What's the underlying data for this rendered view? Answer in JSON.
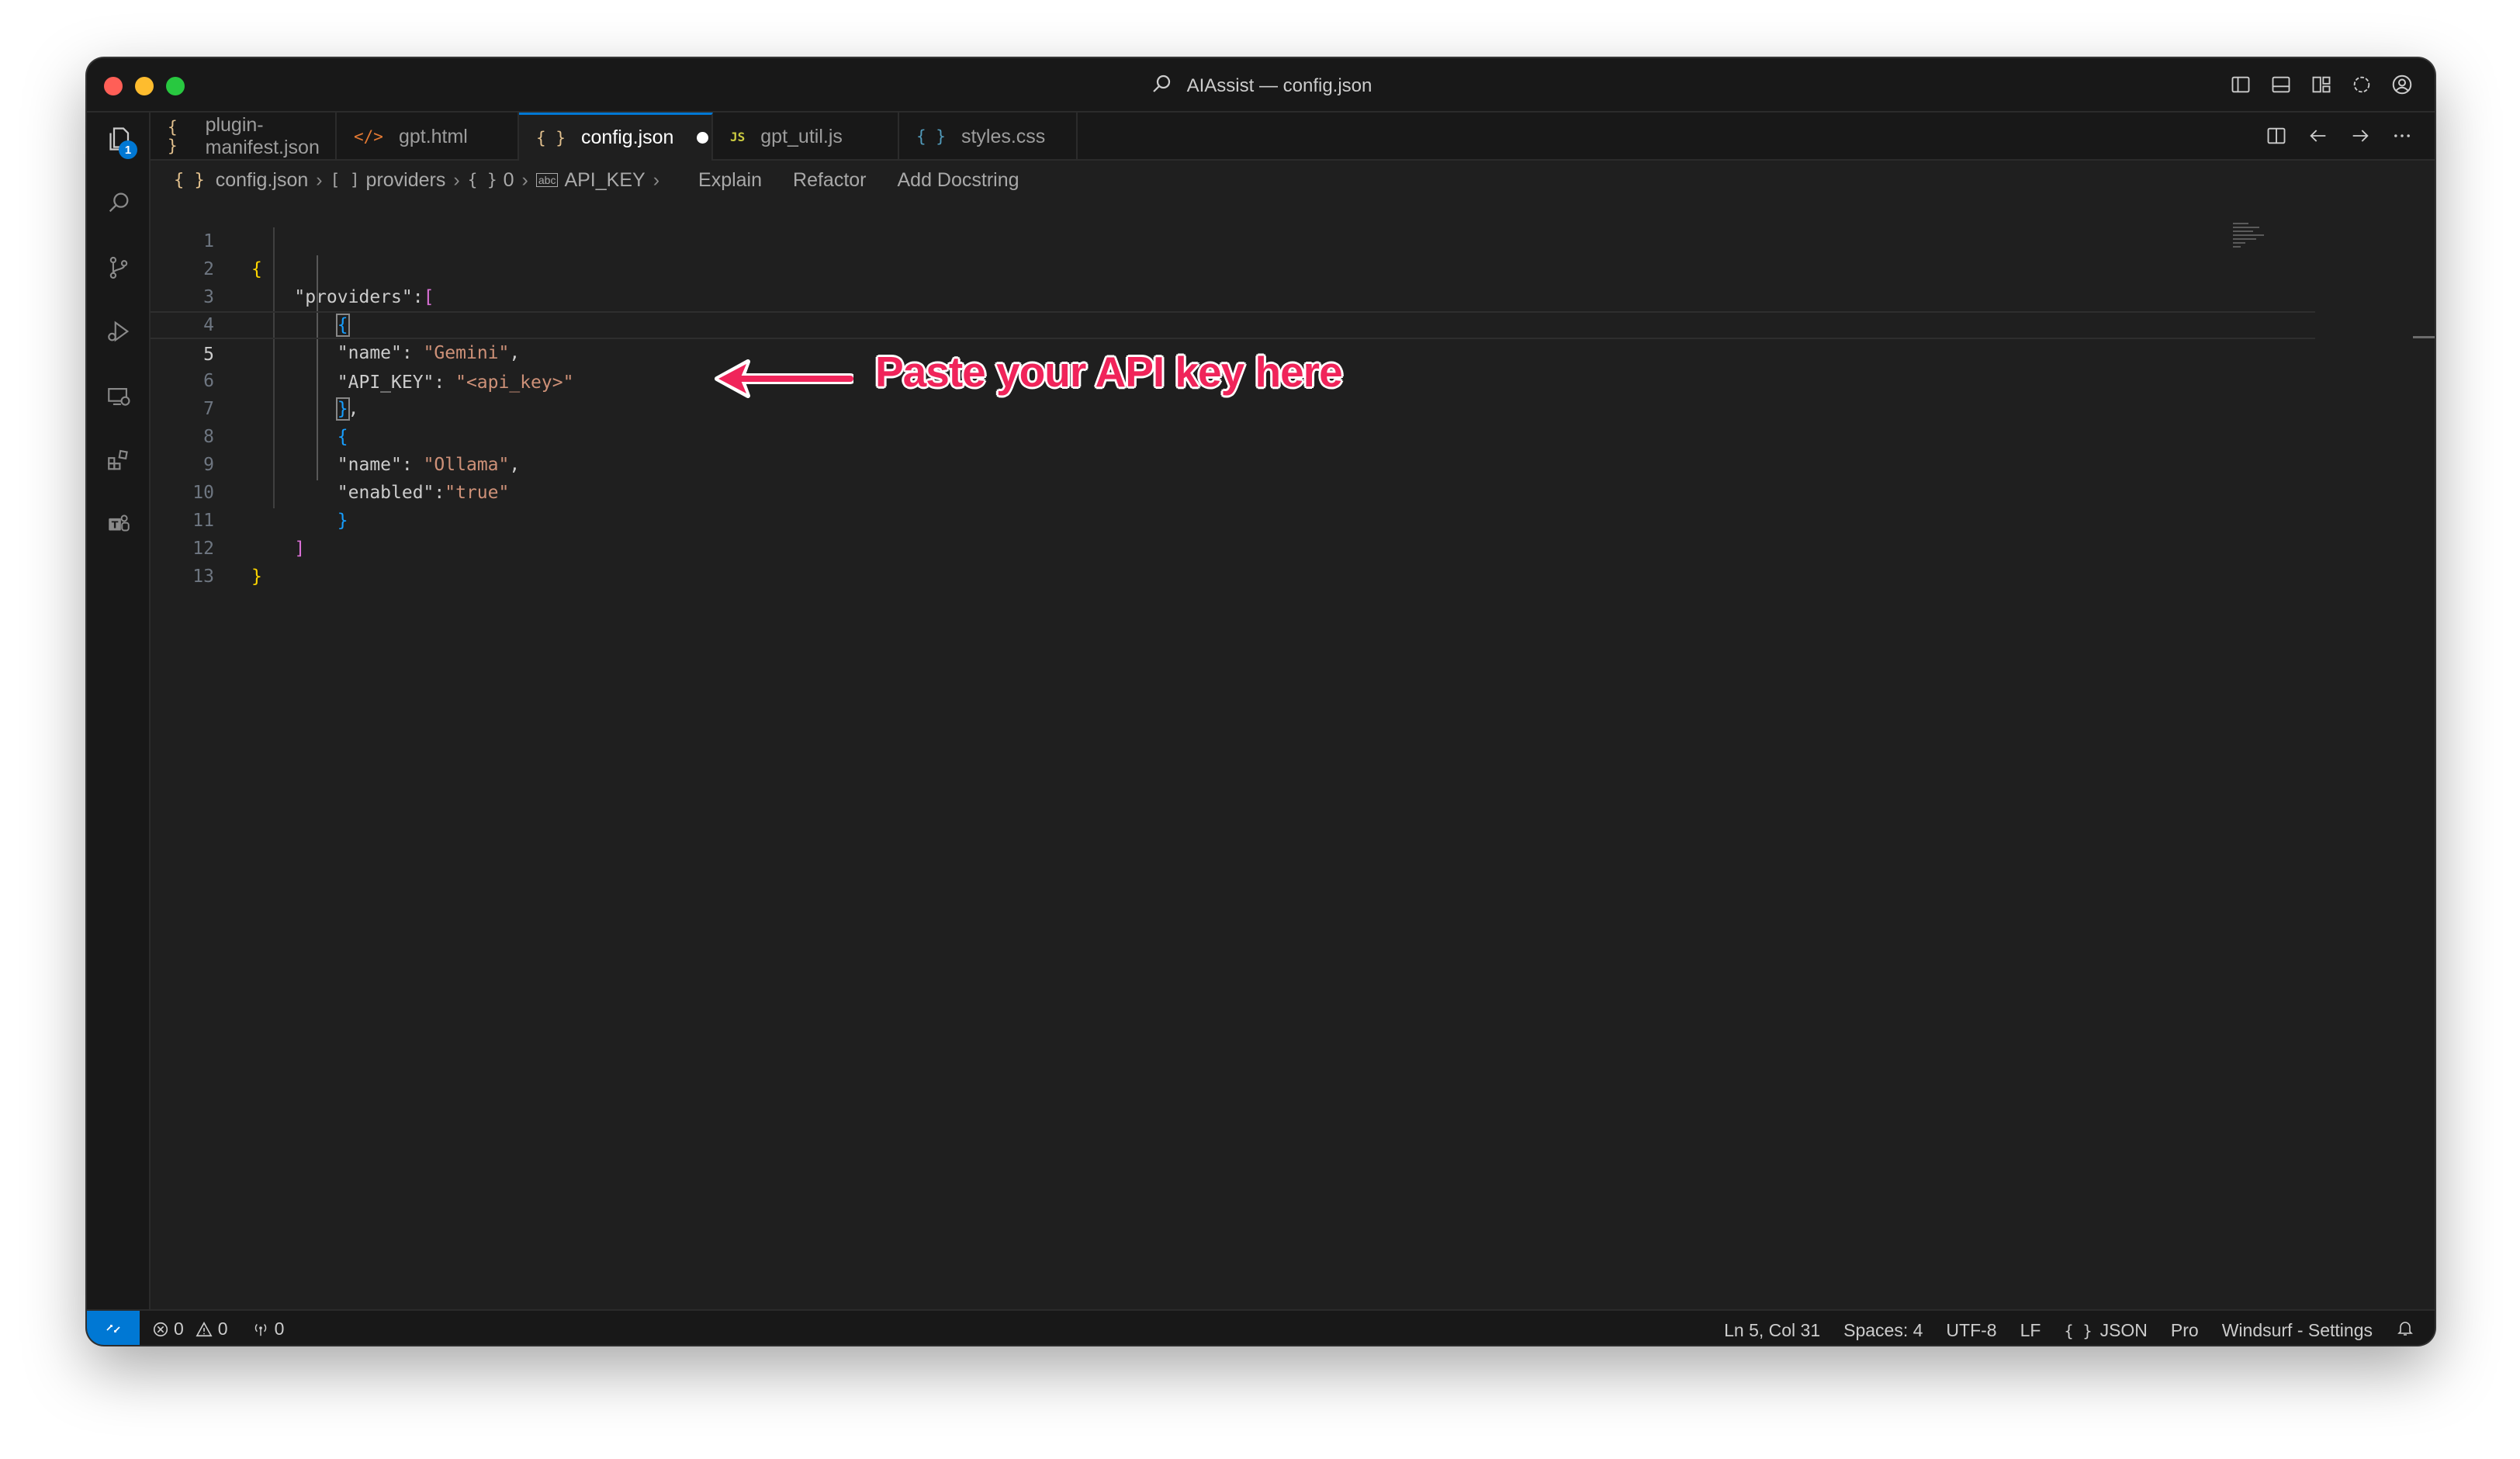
{
  "window": {
    "title": "AIAssist — config.json"
  },
  "tabs": [
    {
      "label": "plugin-manifest.json",
      "icon": "{ }",
      "icon_color": "#e2c08d"
    },
    {
      "label": "gpt.html",
      "icon": "</>",
      "icon_color": "#e37933"
    },
    {
      "label": "config.json",
      "icon": "{ }",
      "icon_color": "#e2c08d",
      "active": true,
      "modified": true
    },
    {
      "label": "gpt_util.js",
      "icon": "JS",
      "icon_color": "#cbcb41"
    },
    {
      "label": "styles.css",
      "icon": "{ }",
      "icon_color": "#519aba"
    }
  ],
  "breadcrumb": {
    "file_icon": "{ }",
    "file": "config.json",
    "providers_icon": "[ ]",
    "providers": "providers",
    "index_icon": "{ }",
    "index": "0",
    "key_icon": "abc",
    "key": "API_KEY",
    "actions": [
      "Explain",
      "Refactor",
      "Add Docstring"
    ]
  },
  "activity": {
    "explorer_badge": "1"
  },
  "code": {
    "current_line": 5,
    "line_numbers": [
      "1",
      "2",
      "3",
      "4",
      "5",
      "6",
      "7",
      "8",
      "9",
      "10",
      "11",
      "12",
      "13"
    ],
    "l2_key": "\"providers\"",
    "l4_key": "\"name\"",
    "l4_val": "\"Gemini\"",
    "l5_key": "\"API_KEY\"",
    "l5_val": "\"<api_key>\"",
    "l8_key": "\"name\"",
    "l8_val": "\"Ollama\"",
    "l9_key": "\"enabled\"",
    "l9_val": "\"true\""
  },
  "annotation": {
    "text": "Paste your API key here",
    "color": "#f0245a"
  },
  "statusbar": {
    "errors": "0",
    "warnings": "0",
    "ports": "0",
    "position": "Ln 5, Col 31",
    "spaces": "Spaces: 4",
    "encoding": "UTF-8",
    "eol": "LF",
    "language_icon": "{ }",
    "language": "JSON",
    "plan": "Pro",
    "windsurf": "Windsurf - Settings"
  },
  "colors": {
    "accent": "#0078d4",
    "string": "#ce9178",
    "bracket_level1": "#ffd700",
    "bracket_level2": "#da70d6",
    "bracket_level3": "#179fff"
  }
}
